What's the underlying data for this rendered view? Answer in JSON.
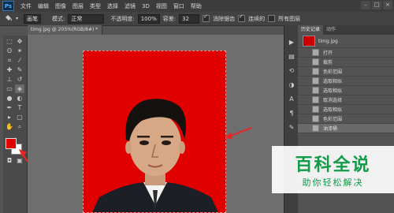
{
  "app": {
    "logo": "Ps"
  },
  "menubar": {
    "items": [
      "文件",
      "编辑",
      "图像",
      "图层",
      "类型",
      "选择",
      "滤镜",
      "3D",
      "视图",
      "窗口",
      "帮助"
    ],
    "window_controls": [
      "–",
      "□",
      "×"
    ]
  },
  "options_bar": {
    "preset": "画笔",
    "mode_label": "模式:",
    "mode_value": "正常",
    "opacity_label": "不透明度:",
    "opacity_value": "100%",
    "tolerance_label": "容差:",
    "tolerance_value": "32",
    "antialias_label": "消除锯齿",
    "contiguous_label": "连续的",
    "all_layers_label": "所有图层"
  },
  "document": {
    "tab_title": "timg.jpg @ 205%(RGB/8#) *"
  },
  "colors": {
    "foreground": "#e00000",
    "background": "#ffffff",
    "photo_bg": "#e00000",
    "accent_green": "#0f9b48"
  },
  "history_panel": {
    "tabs": [
      "历史记录",
      "动作"
    ],
    "snapshot": "timg.jpg",
    "states": [
      "打开",
      "裁剪",
      "色彩范围",
      "选取相似",
      "选取相似",
      "取消选择",
      "选取相似",
      "色彩范围",
      "油漆桶"
    ],
    "selected_index": 8
  },
  "watermark": {
    "title": "百科全说",
    "subtitle": "助你轻松解决"
  }
}
